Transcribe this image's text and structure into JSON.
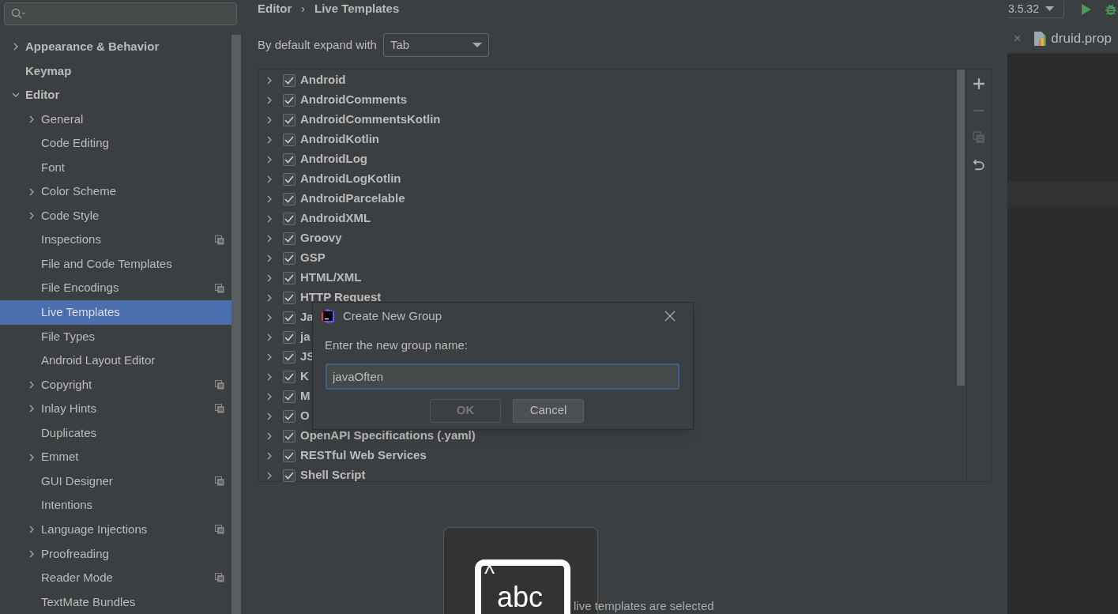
{
  "sidebar": {
    "items": [
      {
        "label": "Appearance & Behavior",
        "expanded": false,
        "selected": false
      },
      {
        "label": "Keymap",
        "selected": false
      },
      {
        "label": "Editor",
        "expanded": true,
        "selected": false,
        "children": [
          {
            "label": "General",
            "expanded": false,
            "selected": false
          },
          {
            "label": "Code Editing",
            "selected": false
          },
          {
            "label": "Font",
            "selected": false
          },
          {
            "label": "Color Scheme",
            "expanded": false,
            "selected": false
          },
          {
            "label": "Code Style",
            "expanded": false,
            "selected": false
          },
          {
            "label": "Inspections",
            "selected": false,
            "project_scoped": true
          },
          {
            "label": "File and Code Templates",
            "selected": false
          },
          {
            "label": "File Encodings",
            "selected": false,
            "project_scoped": true
          },
          {
            "label": "Live Templates",
            "selected": true
          },
          {
            "label": "File Types",
            "selected": false
          },
          {
            "label": "Android Layout Editor",
            "selected": false
          },
          {
            "label": "Copyright",
            "expanded": false,
            "selected": false,
            "project_scoped": true
          },
          {
            "label": "Inlay Hints",
            "expanded": false,
            "selected": false,
            "project_scoped": true
          },
          {
            "label": "Duplicates",
            "selected": false
          },
          {
            "label": "Emmet",
            "expanded": false,
            "selected": false
          },
          {
            "label": "GUI Designer",
            "selected": false,
            "project_scoped": true
          },
          {
            "label": "Intentions",
            "selected": false
          },
          {
            "label": "Language Injections",
            "expanded": false,
            "selected": false,
            "project_scoped": true
          },
          {
            "label": "Proofreading",
            "expanded": false,
            "selected": false
          },
          {
            "label": "Reader Mode",
            "selected": false,
            "project_scoped": true
          },
          {
            "label": "TextMate Bundles",
            "selected": false
          }
        ]
      }
    ]
  },
  "breadcrumb": [
    "Editor",
    "Live Templates"
  ],
  "breadcrumb_separator": "›",
  "expand_with": {
    "label": "By default expand with",
    "value": "Tab"
  },
  "template_groups": [
    {
      "label": "Android",
      "checked": true
    },
    {
      "label": "AndroidComments",
      "checked": true
    },
    {
      "label": "AndroidCommentsKotlin",
      "checked": true
    },
    {
      "label": "AndroidKotlin",
      "checked": true
    },
    {
      "label": "AndroidLog",
      "checked": true
    },
    {
      "label": "AndroidLogKotlin",
      "checked": true
    },
    {
      "label": "AndroidParcelable",
      "checked": true
    },
    {
      "label": "AndroidXML",
      "checked": true
    },
    {
      "label": "Groovy",
      "checked": true
    },
    {
      "label": "GSP",
      "checked": true
    },
    {
      "label": "HTML/XML",
      "checked": true
    },
    {
      "label": "HTTP Request",
      "checked": true
    },
    {
      "label": "Ja",
      "checked": true
    },
    {
      "label": "ja",
      "checked": true
    },
    {
      "label": "JS",
      "checked": true
    },
    {
      "label": "K",
      "checked": true
    },
    {
      "label": "M",
      "checked": true
    },
    {
      "label": "O",
      "checked": true
    },
    {
      "label": "OpenAPI Specifications (.yaml)",
      "checked": true
    },
    {
      "label": "RESTful Web Services",
      "checked": true
    },
    {
      "label": "Shell Script",
      "checked": true
    }
  ],
  "toolbar": [
    {
      "kind": "add",
      "disabled": false
    },
    {
      "kind": "remove",
      "disabled": true
    },
    {
      "kind": "copy",
      "disabled": true
    },
    {
      "kind": "restore",
      "disabled": false
    }
  ],
  "empty_state": {
    "key_caret": "^",
    "key_text": "abc",
    "message": "live templates are selected"
  },
  "dialog": {
    "title": "Create New Group",
    "prompt": "Enter the new group name:",
    "value": "javaOften",
    "buttons": [
      {
        "label": "OK",
        "disabled": true
      },
      {
        "label": "Cancel",
        "disabled": false
      }
    ]
  },
  "ide": {
    "run_config": "3.5.32",
    "tab_close": "×",
    "tab": "druid.prop"
  }
}
